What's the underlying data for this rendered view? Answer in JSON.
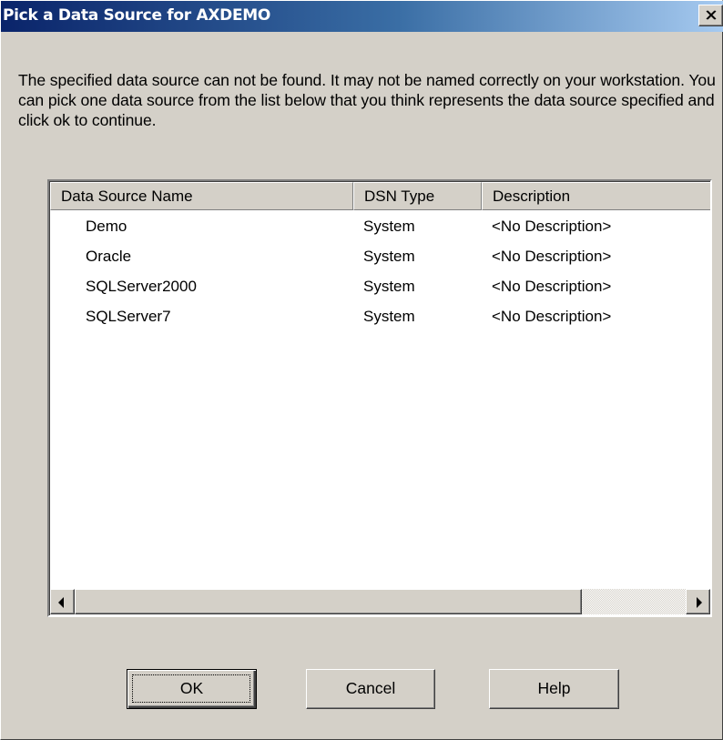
{
  "window": {
    "title": "Pick a Data Source for AXDEMO",
    "close_icon": "close-icon"
  },
  "message": "The specified data source can not be found. It may not be named correctly on your workstation. You can pick one data source from the list below that you think represents the data source specified and click ok to continue.",
  "list": {
    "columns": [
      "Data Source Name",
      "DSN Type",
      "Description"
    ],
    "rows": [
      {
        "name": "Demo",
        "type": "System",
        "description": "<No Description>"
      },
      {
        "name": "Oracle",
        "type": "System",
        "description": "<No Description>"
      },
      {
        "name": "SQLServer2000",
        "type": "System",
        "description": "<No Description>"
      },
      {
        "name": "SQLServer7",
        "type": "System",
        "description": "<No Description>"
      }
    ],
    "scrollbar": {
      "left_icon": "arrow-left-icon",
      "right_icon": "arrow-right-icon",
      "thumb_fraction": 0.83,
      "position": 0
    }
  },
  "buttons": {
    "ok": "OK",
    "cancel": "Cancel",
    "help": "Help"
  },
  "colors": {
    "title_gradient_start": "#0a246a",
    "title_gradient_end": "#a6caf0",
    "face": "#d4d0c8"
  }
}
